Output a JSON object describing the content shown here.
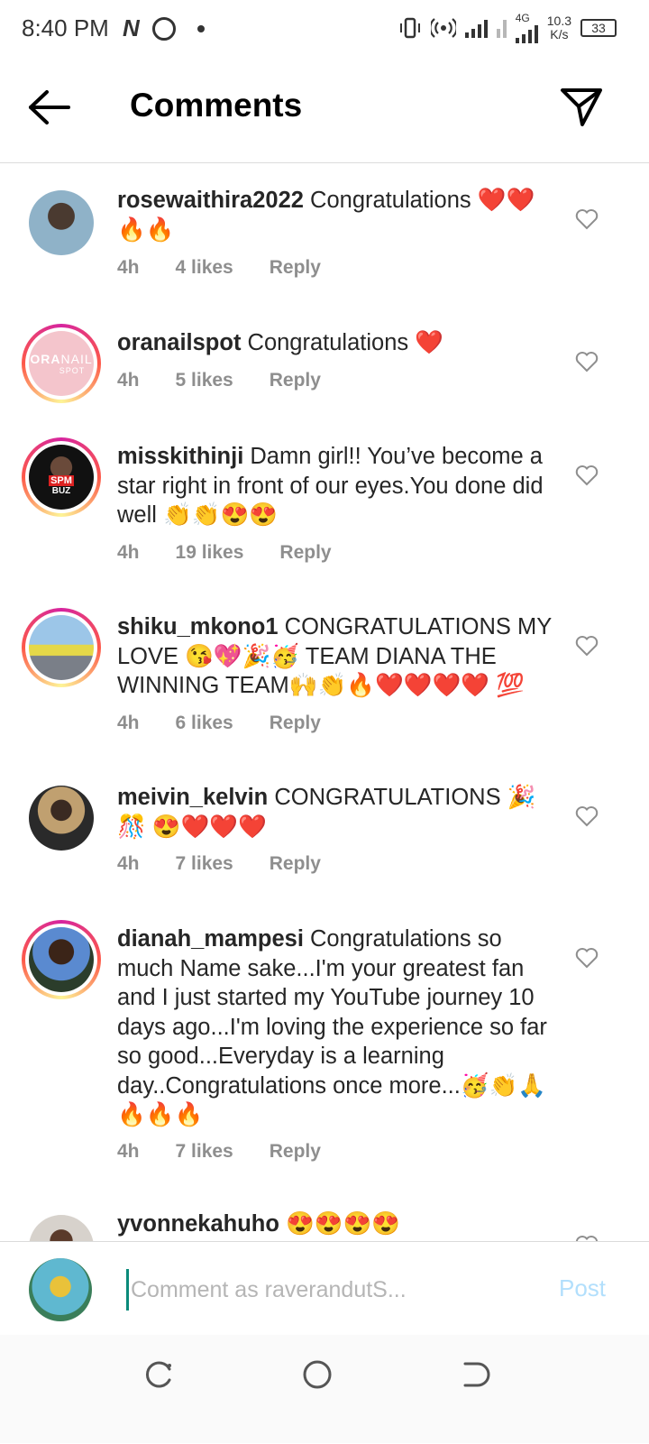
{
  "status_bar": {
    "time": "8:40 PM",
    "network": "4G",
    "speed_value": "10.3",
    "speed_unit": "K/s",
    "battery": "33"
  },
  "header": {
    "title": "Comments",
    "back_icon": "arrow-left-icon",
    "share_icon": "paper-plane-icon"
  },
  "comments": [
    {
      "username": "rosewaithira2022",
      "text": "Congratulations ❤️❤️🔥🔥",
      "time": "4h",
      "likes": "4 likes",
      "reply": "Reply"
    },
    {
      "username": "oranailspot",
      "text": "Congratulations ❤️",
      "time": "4h",
      "likes": "5 likes",
      "reply": "Reply",
      "avatar_logo_main": "ORA",
      "avatar_logo_sub1": "NAIL",
      "avatar_logo_sub2": "SPOT"
    },
    {
      "username": "misskithinji",
      "text": "Damn girl!! You’ve become a star right in front of our eyes.You done did well 👏👏😍😍",
      "time": "4h",
      "likes": "19 likes",
      "reply": "Reply",
      "avatar_logo_main": "SPM",
      "avatar_logo_sub1": "BUZ"
    },
    {
      "username": "shiku_mkono1",
      "text": "CONGRATULATIONS MY LOVE 😘💖🎉🥳 TEAM DIANA THE WINNING TEAM🙌👏🔥❤️❤️❤️❤️ 💯",
      "time": "4h",
      "likes": "6 likes",
      "reply": "Reply"
    },
    {
      "username": "meivin_kelvin",
      "text": "CONGRATULATIONS 🎉🎊 😍❤️❤️❤️",
      "time": "4h",
      "likes": "7 likes",
      "reply": "Reply"
    },
    {
      "username": "dianah_mampesi",
      "text": "Congratulations so much Name sake...I'm your greatest fan and I just started my YouTube journey 10 days ago...I'm loving the experience so far so good...Everyday is a learning day..Congratulations once more...🥳👏🙏🔥🔥🔥",
      "time": "4h",
      "likes": "7 likes",
      "reply": "Reply"
    },
    {
      "username": "yvonnekahuho",
      "text": "😍😍😍😍"
    }
  ],
  "footer": {
    "input_placeholder": "Comment as raverandutS...",
    "post_label": "Post"
  },
  "colors": {
    "text": "#262626",
    "meta": "#8e8e8e",
    "post_disabled": "#b2dffc",
    "heart_like": "#ed4956"
  }
}
